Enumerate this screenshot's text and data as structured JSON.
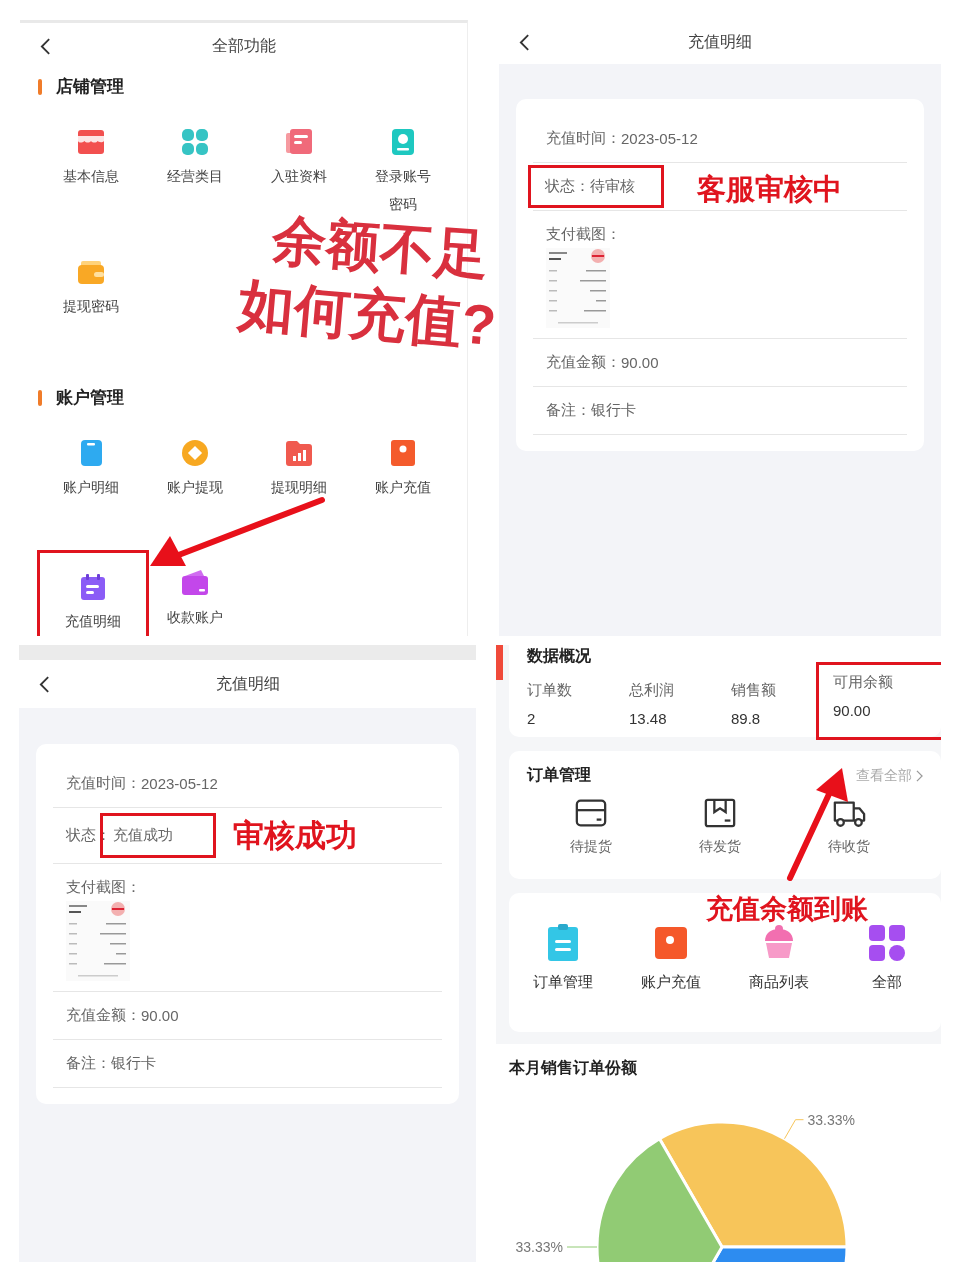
{
  "all_functions": {
    "title": "全部功能",
    "note": [
      "余额不足",
      "如何充值?"
    ],
    "sections": [
      {
        "title": "店铺管理",
        "items": [
          {
            "label": "基本信息",
            "highlighted": false
          },
          {
            "label": "经营类目",
            "highlighted": false
          },
          {
            "label": "入驻资料",
            "highlighted": false
          },
          {
            "label": "登录账号密码",
            "highlighted": false
          },
          {
            "label": "提现密码",
            "highlighted": false
          }
        ]
      },
      {
        "title": "账户管理",
        "items": [
          {
            "label": "账户明细",
            "highlighted": false
          },
          {
            "label": "账户提现",
            "highlighted": false
          },
          {
            "label": "提现明细",
            "highlighted": false
          },
          {
            "label": "账户充值",
            "highlighted": false
          },
          {
            "label": "充值明细",
            "highlighted": true
          },
          {
            "label": "收款账户",
            "highlighted": false
          }
        ]
      }
    ]
  },
  "recharge_pending": {
    "title": "充值明细",
    "note": "客服审核中",
    "rows": [
      {
        "kind": "field",
        "label": "充值时间：",
        "value": "2023-05-12",
        "label_highlighted": false,
        "value_highlighted": false
      },
      {
        "kind": "field",
        "label": "状态：",
        "value": "待审核",
        "label_highlighted": true,
        "value_highlighted": true
      },
      {
        "label": "支付截图：",
        "label_highlighted": false,
        "value_highlighted": false
      },
      {
        "kind": "field",
        "label": "充值金额：",
        "value": "90.00",
        "label_highlighted": false,
        "value_highlighted": false
      },
      {
        "kind": "field",
        "label": "备注：",
        "value": "银行卡",
        "label_highlighted": false,
        "value_highlighted": false
      }
    ]
  },
  "recharge_success": {
    "title": "充值明细",
    "note": "审核成功",
    "rows": [
      {
        "kind": "field",
        "label": "充值时间：",
        "value": "2023-05-12",
        "label_highlighted": false,
        "value_highlighted": false
      },
      {
        "kind": "field",
        "label": "状态：",
        "value": "充值成功",
        "label_highlighted": false,
        "value_highlighted": true
      },
      {
        "label": "支付截图：",
        "label_highlighted": false,
        "value_highlighted": false
      },
      {
        "kind": "field",
        "label": "充值金额：",
        "value": "90.00",
        "label_highlighted": false,
        "value_highlighted": false
      },
      {
        "kind": "field",
        "label": "备注：",
        "value": "银行卡",
        "label_highlighted": false,
        "value_highlighted": false
      }
    ]
  },
  "dashboard": {
    "note": "充值余额到账",
    "overview": {
      "title": "数据概况",
      "stats": [
        {
          "label": "订单数",
          "value": "2",
          "highlighted": false
        },
        {
          "label": "总利润",
          "value": "13.48",
          "highlighted": false
        },
        {
          "label": "销售额",
          "value": "89.8",
          "highlighted": false
        },
        {
          "label": "可用余额",
          "value": "90.00",
          "highlighted": true
        }
      ]
    },
    "orders": {
      "title": "订单管理",
      "link": "查看全部",
      "items": [
        "待提货",
        "待发货",
        "待收货"
      ]
    },
    "shortcuts": [
      "订单管理",
      "账户充值",
      "商品列表",
      "全部"
    ],
    "sales": {
      "title": "本月销售订单份额",
      "chart_data": {
        "type": "pie",
        "values": [
          33.33,
          33.33,
          33.33
        ],
        "colors": [
          "#f7c55a",
          "#2d8cf0",
          "#91cb74"
        ],
        "value_labels": [
          "33.33%",
          null,
          "33.33%"
        ]
      }
    }
  }
}
